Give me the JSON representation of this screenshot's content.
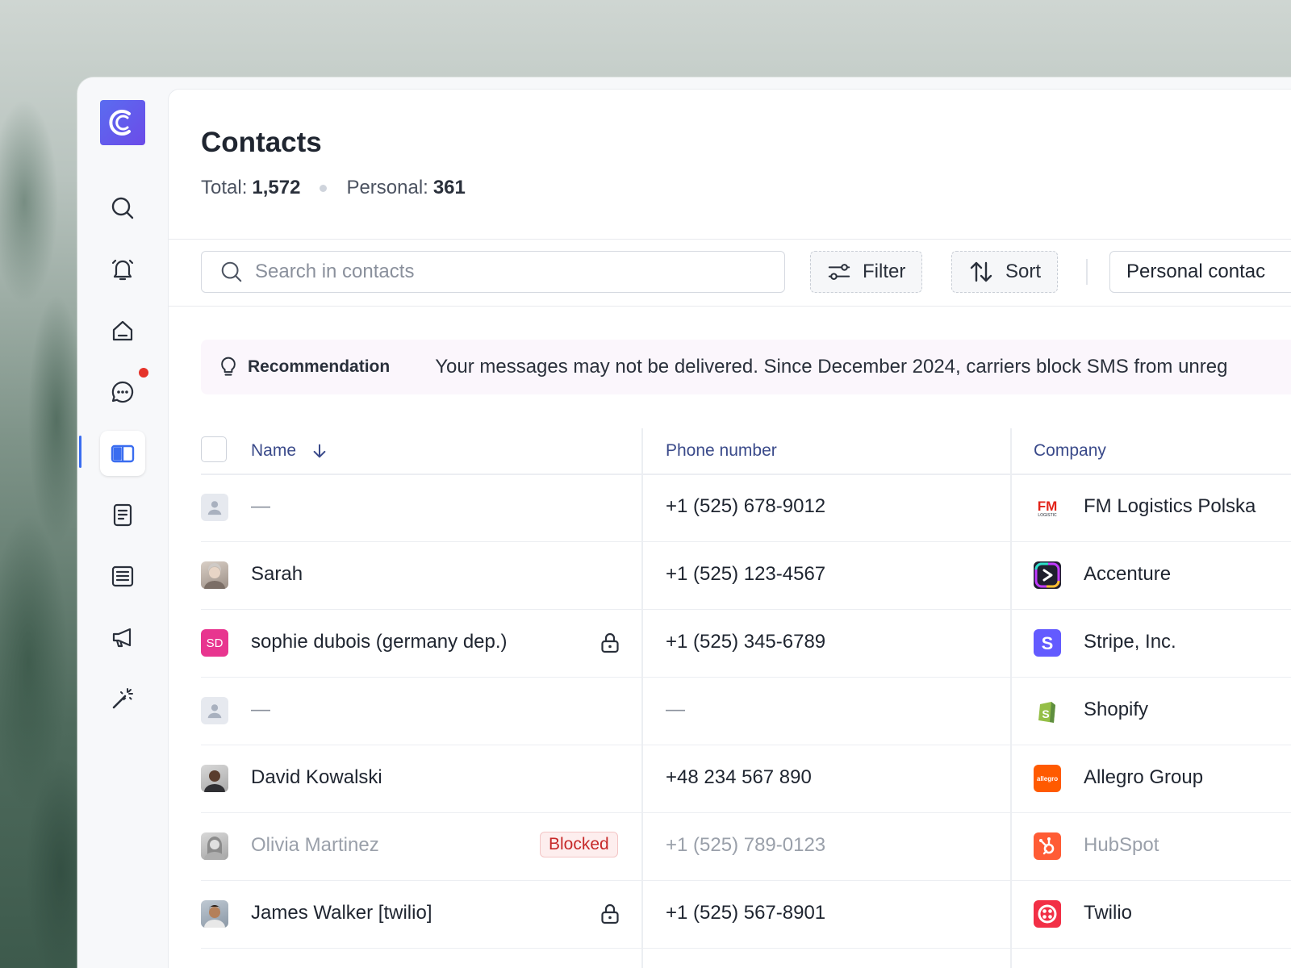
{
  "page": {
    "title": "Contacts"
  },
  "stats": {
    "total_label": "Total:",
    "total_value": "1,572",
    "personal_label": "Personal:",
    "personal_value": "361"
  },
  "toolbar": {
    "search_placeholder": "Search in contacts",
    "filter_label": "Filter",
    "sort_label": "Sort",
    "view_select_value": "Personal contac"
  },
  "recommendation": {
    "label": "Recommendation",
    "message": "Your messages may not be delivered. Since December 2024, carriers block SMS from unreg"
  },
  "table": {
    "columns": [
      "Name",
      "Phone number",
      "Company"
    ],
    "rows": [
      {
        "name": "—",
        "phone": "+1 (525) 678-9012",
        "company": "FM Logistics Polska",
        "avatar": "placeholder",
        "company_icon": "fm-logistics-logo"
      },
      {
        "name": "Sarah",
        "phone": "+1 (525) 123-4567",
        "company": "Accenture",
        "avatar": "photo",
        "company_icon": "accenture-logo"
      },
      {
        "name": "sophie dubois (germany dep.)",
        "phone": "+1 (525) 345-6789",
        "company": "Stripe, Inc.",
        "avatar": "initials",
        "initials": "SD",
        "locked": true,
        "company_icon": "stripe-logo"
      },
      {
        "name": "—",
        "phone": "—",
        "company": "Shopify",
        "avatar": "placeholder",
        "company_icon": "shopify-logo"
      },
      {
        "name": "David Kowalski",
        "phone": "+48 234 567 890",
        "company": "Allegro Group",
        "avatar": "photo",
        "company_icon": "allegro-logo",
        "company_logo_text": "allegro"
      },
      {
        "name": "Olivia Martinez",
        "phone": "+1 (525) 789-0123",
        "company": "HubSpot",
        "avatar": "photo",
        "blocked": true,
        "blocked_label": "Blocked",
        "company_icon": "hubspot-logo"
      },
      {
        "name": "James Walker [twilio]",
        "phone": "+1 (525) 567-8901",
        "company": "Twilio",
        "avatar": "photo",
        "locked": true,
        "company_icon": "twilio-logo"
      }
    ]
  },
  "sidebar": {
    "items": [
      "search-icon",
      "bell-icon",
      "home-icon",
      "chat-icon",
      "contacts-book-icon",
      "document-icon",
      "list-icon",
      "megaphone-icon",
      "magic-wand-icon"
    ],
    "active": "contacts-book-icon"
  },
  "colors": {
    "accent": "#3a6df0",
    "brand_gradient_start": "#5a6cf0",
    "brand_gradient_end": "#6c4be8",
    "blocked": "#c62828",
    "notification": "#e5332a"
  }
}
